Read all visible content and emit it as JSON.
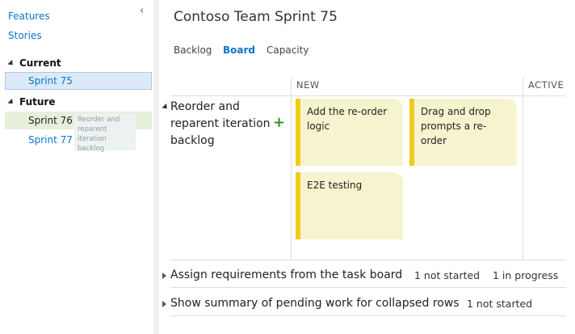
{
  "left_panel": {
    "links": [
      "Features",
      "Stories"
    ],
    "collapse_glyph": "‹",
    "groups": {
      "current": {
        "label": "Current",
        "sprints": [
          "Sprint 75"
        ]
      },
      "future": {
        "label": "Future",
        "sprints": [
          "Sprint 76",
          "Sprint 77"
        ]
      }
    },
    "drag_ghost": "Reorder and reparent iteration backlog"
  },
  "header": {
    "title": "Contoso Team Sprint 75",
    "tabs": [
      {
        "label": "Backlog",
        "active": false
      },
      {
        "label": "Board",
        "active": true
      },
      {
        "label": "Capacity",
        "active": false
      }
    ]
  },
  "board": {
    "columns": [
      "NEW",
      "ACTIVE"
    ],
    "add_glyph": "+",
    "rows": [
      {
        "title": "Reorder and reparent iteration backlog",
        "expanded": true,
        "cards": [
          "Add the re-order logic",
          "Drag and drop prompts a re-order",
          "E2E testing"
        ]
      },
      {
        "title": "Assign requirements from the task board",
        "expanded": false,
        "summary": [
          "1 not started",
          "1 in progress"
        ]
      },
      {
        "title": "Show summary of pending work for collapsed rows",
        "expanded": false,
        "summary": [
          "1 not started"
        ]
      }
    ]
  },
  "colors": {
    "accent": "#0a74c8",
    "card_bg": "#f6f4cf",
    "card_stripe": "#f1cb1b",
    "add_green": "#3a8f22"
  }
}
